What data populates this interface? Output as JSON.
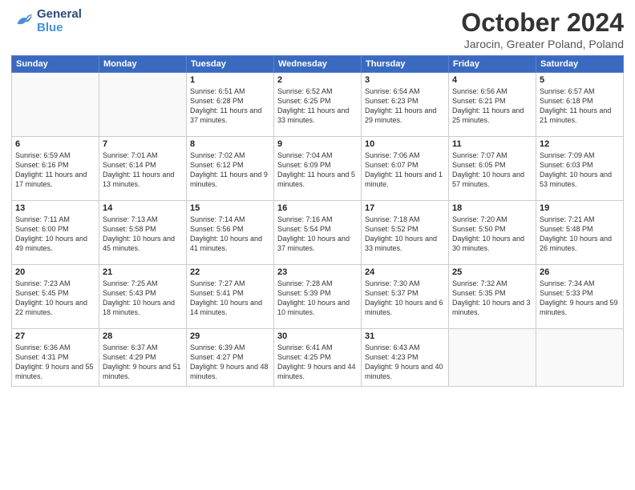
{
  "header": {
    "logo_line1": "General",
    "logo_line2": "Blue",
    "month_title": "October 2024",
    "location": "Jarocin, Greater Poland, Poland"
  },
  "days_of_week": [
    "Sunday",
    "Monday",
    "Tuesday",
    "Wednesday",
    "Thursday",
    "Friday",
    "Saturday"
  ],
  "weeks": [
    [
      {
        "num": "",
        "info": ""
      },
      {
        "num": "",
        "info": ""
      },
      {
        "num": "1",
        "info": "Sunrise: 6:51 AM\nSunset: 6:28 PM\nDaylight: 11 hours and 37 minutes."
      },
      {
        "num": "2",
        "info": "Sunrise: 6:52 AM\nSunset: 6:25 PM\nDaylight: 11 hours and 33 minutes."
      },
      {
        "num": "3",
        "info": "Sunrise: 6:54 AM\nSunset: 6:23 PM\nDaylight: 11 hours and 29 minutes."
      },
      {
        "num": "4",
        "info": "Sunrise: 6:56 AM\nSunset: 6:21 PM\nDaylight: 11 hours and 25 minutes."
      },
      {
        "num": "5",
        "info": "Sunrise: 6:57 AM\nSunset: 6:18 PM\nDaylight: 11 hours and 21 minutes."
      }
    ],
    [
      {
        "num": "6",
        "info": "Sunrise: 6:59 AM\nSunset: 6:16 PM\nDaylight: 11 hours and 17 minutes."
      },
      {
        "num": "7",
        "info": "Sunrise: 7:01 AM\nSunset: 6:14 PM\nDaylight: 11 hours and 13 minutes."
      },
      {
        "num": "8",
        "info": "Sunrise: 7:02 AM\nSunset: 6:12 PM\nDaylight: 11 hours and 9 minutes."
      },
      {
        "num": "9",
        "info": "Sunrise: 7:04 AM\nSunset: 6:09 PM\nDaylight: 11 hours and 5 minutes."
      },
      {
        "num": "10",
        "info": "Sunrise: 7:06 AM\nSunset: 6:07 PM\nDaylight: 11 hours and 1 minute."
      },
      {
        "num": "11",
        "info": "Sunrise: 7:07 AM\nSunset: 6:05 PM\nDaylight: 10 hours and 57 minutes."
      },
      {
        "num": "12",
        "info": "Sunrise: 7:09 AM\nSunset: 6:03 PM\nDaylight: 10 hours and 53 minutes."
      }
    ],
    [
      {
        "num": "13",
        "info": "Sunrise: 7:11 AM\nSunset: 6:00 PM\nDaylight: 10 hours and 49 minutes."
      },
      {
        "num": "14",
        "info": "Sunrise: 7:13 AM\nSunset: 5:58 PM\nDaylight: 10 hours and 45 minutes."
      },
      {
        "num": "15",
        "info": "Sunrise: 7:14 AM\nSunset: 5:56 PM\nDaylight: 10 hours and 41 minutes."
      },
      {
        "num": "16",
        "info": "Sunrise: 7:16 AM\nSunset: 5:54 PM\nDaylight: 10 hours and 37 minutes."
      },
      {
        "num": "17",
        "info": "Sunrise: 7:18 AM\nSunset: 5:52 PM\nDaylight: 10 hours and 33 minutes."
      },
      {
        "num": "18",
        "info": "Sunrise: 7:20 AM\nSunset: 5:50 PM\nDaylight: 10 hours and 30 minutes."
      },
      {
        "num": "19",
        "info": "Sunrise: 7:21 AM\nSunset: 5:48 PM\nDaylight: 10 hours and 26 minutes."
      }
    ],
    [
      {
        "num": "20",
        "info": "Sunrise: 7:23 AM\nSunset: 5:45 PM\nDaylight: 10 hours and 22 minutes."
      },
      {
        "num": "21",
        "info": "Sunrise: 7:25 AM\nSunset: 5:43 PM\nDaylight: 10 hours and 18 minutes."
      },
      {
        "num": "22",
        "info": "Sunrise: 7:27 AM\nSunset: 5:41 PM\nDaylight: 10 hours and 14 minutes."
      },
      {
        "num": "23",
        "info": "Sunrise: 7:28 AM\nSunset: 5:39 PM\nDaylight: 10 hours and 10 minutes."
      },
      {
        "num": "24",
        "info": "Sunrise: 7:30 AM\nSunset: 5:37 PM\nDaylight: 10 hours and 6 minutes."
      },
      {
        "num": "25",
        "info": "Sunrise: 7:32 AM\nSunset: 5:35 PM\nDaylight: 10 hours and 3 minutes."
      },
      {
        "num": "26",
        "info": "Sunrise: 7:34 AM\nSunset: 5:33 PM\nDaylight: 9 hours and 59 minutes."
      }
    ],
    [
      {
        "num": "27",
        "info": "Sunrise: 6:36 AM\nSunset: 4:31 PM\nDaylight: 9 hours and 55 minutes."
      },
      {
        "num": "28",
        "info": "Sunrise: 6:37 AM\nSunset: 4:29 PM\nDaylight: 9 hours and 51 minutes."
      },
      {
        "num": "29",
        "info": "Sunrise: 6:39 AM\nSunset: 4:27 PM\nDaylight: 9 hours and 48 minutes."
      },
      {
        "num": "30",
        "info": "Sunrise: 6:41 AM\nSunset: 4:25 PM\nDaylight: 9 hours and 44 minutes."
      },
      {
        "num": "31",
        "info": "Sunrise: 6:43 AM\nSunset: 4:23 PM\nDaylight: 9 hours and 40 minutes."
      },
      {
        "num": "",
        "info": ""
      },
      {
        "num": "",
        "info": ""
      }
    ]
  ]
}
